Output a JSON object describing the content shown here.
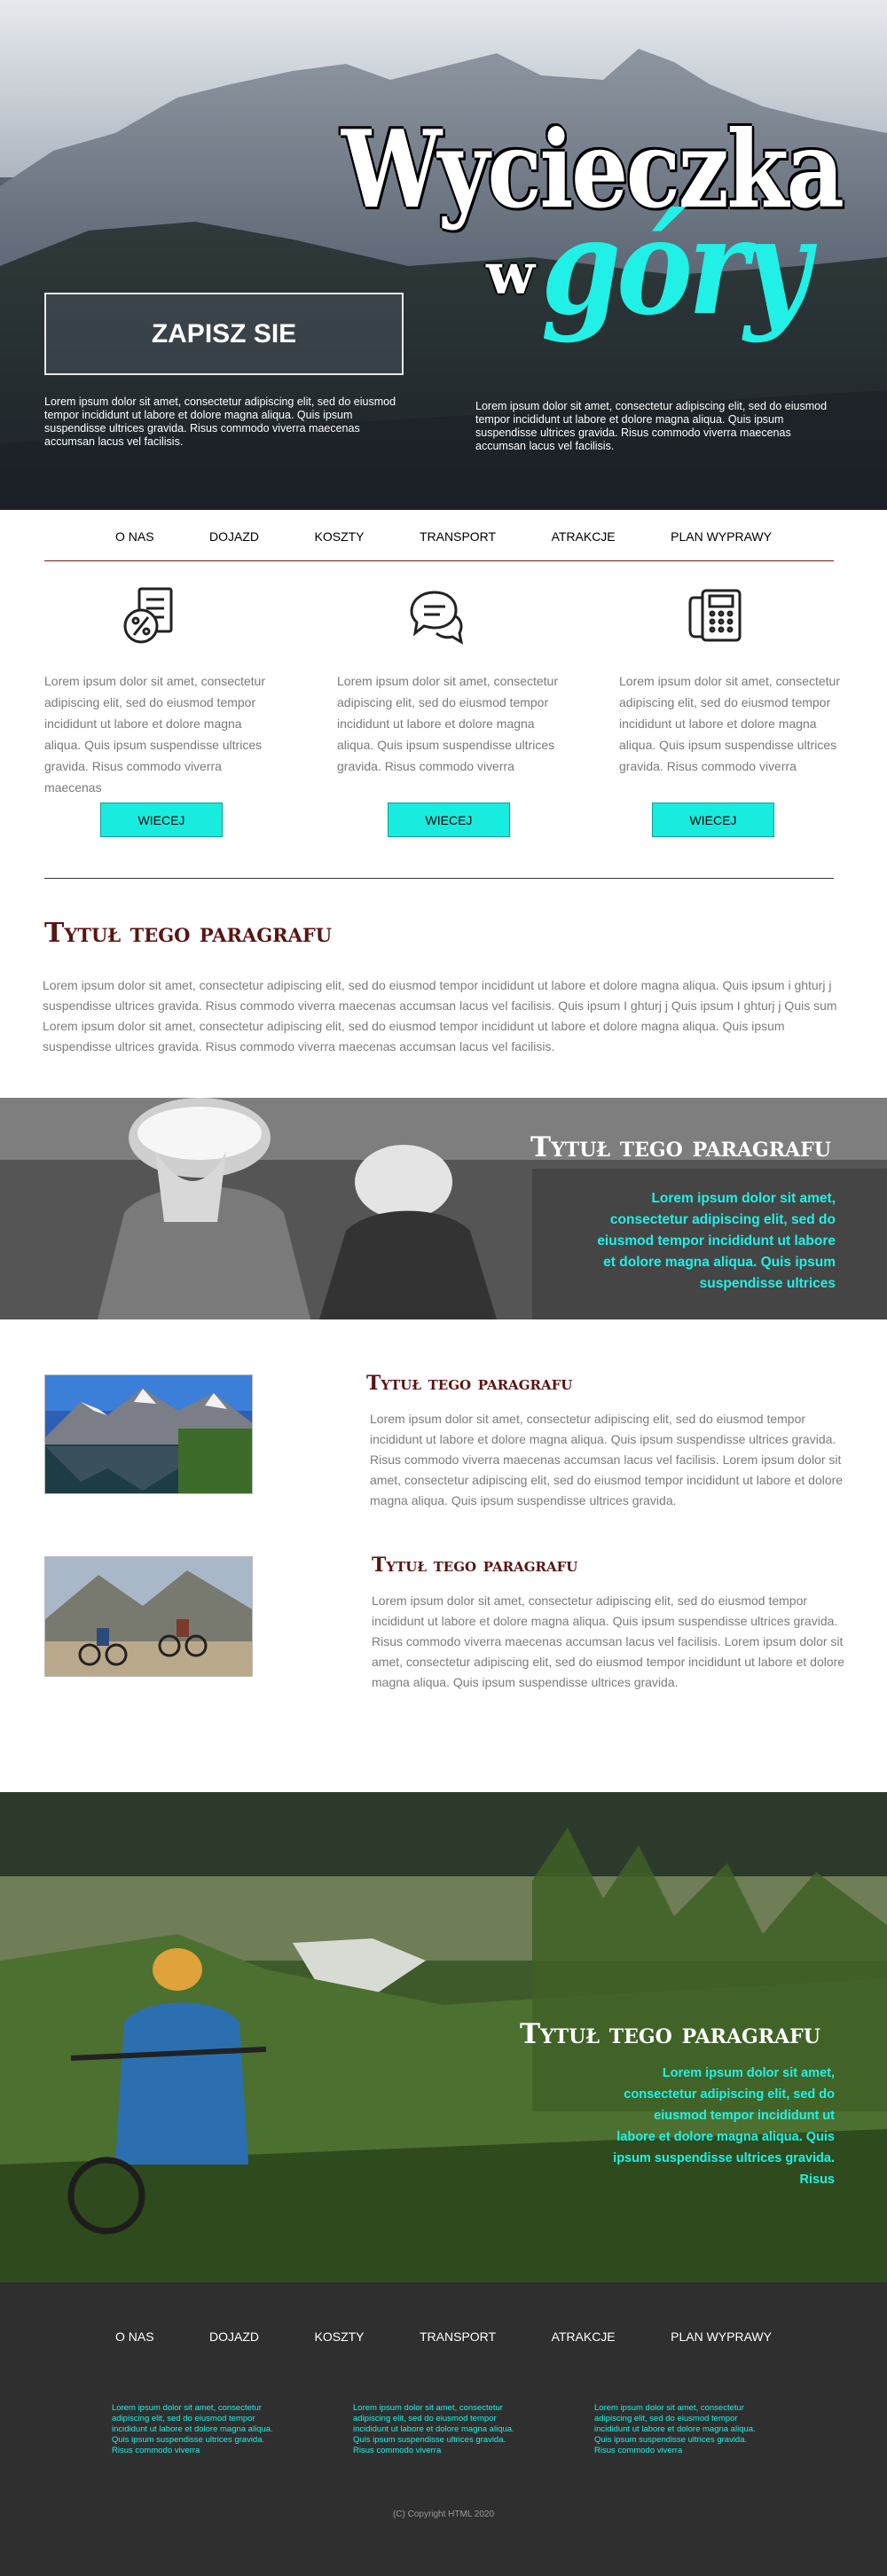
{
  "hero": {
    "title_line1": "Wycieczka",
    "title_w": "w",
    "title_gory": "góry",
    "cta_label": "ZAPISZ SIE",
    "left_text": "Lorem ipsum dolor sit amet, consectetur adipiscing elit, sed do eiusmod tempor incididunt ut labore et dolore magna aliqua. Quis ipsum suspendisse ultrices gravida. Risus commodo viverra maecenas accumsan lacus vel facilisis.",
    "right_text": "Lorem ipsum dolor sit amet, consectetur adipiscing elit, sed do eiusmod tempor incididunt ut labore et dolore magna aliqua. Quis ipsum suspendisse ultrices gravida. Risus commodo viverra maecenas accumsan lacus vel facilisis."
  },
  "nav": {
    "items": [
      {
        "label": "O NAS"
      },
      {
        "label": "DOJAZD"
      },
      {
        "label": "KOSZTY"
      },
      {
        "label": "TRANSPORT"
      },
      {
        "label": "ATRAKCJE"
      },
      {
        "label": "PLAN WYPRAWY"
      }
    ]
  },
  "services": [
    {
      "icon": "percent-document-icon",
      "text": "Lorem ipsum dolor sit amet, consectetur adipiscing elit, sed do eiusmod tempor incididunt ut labore et dolore magna aliqua. Quis ipsum suspendisse ultrices gravida. Risus commodo viverra maecenas",
      "button": "WIECEJ"
    },
    {
      "icon": "chat-bubbles-icon",
      "text": "Lorem ipsum dolor sit amet, consectetur adipiscing elit, sed do eiusmod tempor incididunt ut labore et dolore magna aliqua. Quis ipsum suspendisse ultrices gravida. Risus commodo viverra",
      "button": "WIECEJ"
    },
    {
      "icon": "phone-icon",
      "text": "Lorem ipsum dolor sit amet, consectetur adipiscing elit, sed do eiusmod tempor incididunt ut labore et dolore magna aliqua. Quis ipsum suspendisse ultrices gravida. Risus commodo viverra",
      "button": "WIECEJ"
    }
  ],
  "section1": {
    "title": "Tytuł tego paragrafu",
    "text": "Lorem ipsum dolor sit amet, consectetur adipiscing elit, sed do eiusmod tempor incididunt ut labore et dolore magna aliqua. Quis ipsum i ghturj j suspendisse ultrices gravida. Risus commodo viverra maecenas accumsan lacus vel facilisis. Quis ipsum I ghturj j Quis ipsum I ghturj j Quis sum Lorem ipsum dolor sit amet, consectetur adipiscing elit, sed do eiusmod tempor incididunt ut labore et dolore magna aliqua. Quis ipsum suspendisse ultrices gravida. Risus commodo viverra maecenas accumsan lacus vel facilisis."
  },
  "banner1": {
    "title": "Tytuł tego paragrafu",
    "text": "Lorem ipsum dolor sit amet, consectetur adipiscing elit, sed do eiusmod tempor incididunt ut labore et dolore magna aliqua. Quis ipsum suspendisse ultrices"
  },
  "articles": [
    {
      "title": "Tytuł tego paragrafu",
      "text": "Lorem ipsum dolor sit amet, consectetur adipiscing elit, sed do eiusmod tempor incididunt ut labore et dolore magna aliqua. Quis ipsum suspendisse ultrices gravida. Risus commodo viverra maecenas accumsan lacus vel facilisis. Lorem ipsum dolor sit amet, consectetur adipiscing elit, sed do eiusmod tempor incididunt ut labore et dolore magna aliqua. Quis ipsum suspendisse ultrices gravida."
    },
    {
      "title": "Tytuł tego paragrafu",
      "text": "Lorem ipsum dolor sit amet, consectetur adipiscing elit, sed do eiusmod tempor incididunt ut labore et dolore magna aliqua. Quis ipsum suspendisse ultrices gravida. Risus commodo viverra maecenas accumsan lacus vel facilisis. Lorem ipsum dolor sit amet, consectetur adipiscing elit, sed do eiusmod tempor incididunt ut labore et dolore magna aliqua. Quis ipsum suspendisse ultrices gravida."
    }
  ],
  "banner2": {
    "title": "Tytuł tego paragrafu",
    "text": "Lorem ipsum dolor sit amet, consectetur adipiscing elit, sed do eiusmod tempor incididunt ut labore et dolore magna aliqua. Quis ipsum suspendisse ultrices gravida. Risus"
  },
  "footer": {
    "columns": [
      {
        "text": "Lorem ipsum dolor sit amet, consectetur adipiscing elit, sed do eiusmod tempor incididunt ut labore et dolore magna aliqua. Quis ipsum suspendisse ultrices gravida. Risus commodo viverra"
      },
      {
        "text": "Lorem ipsum dolor sit amet, consectetur adipiscing elit, sed do eiusmod tempor incididunt ut labore et dolore magna aliqua. Quis ipsum suspendisse ultrices gravida. Risus commodo viverra"
      },
      {
        "text": "Lorem ipsum dolor sit amet, consectetur adipiscing elit, sed do eiusmod tempor incididunt ut labore et dolore magna aliqua. Quis ipsum suspendisse ultrices gravida. Risus commodo viverra"
      }
    ],
    "copyright": "(C) Copyright HTML 2020"
  },
  "colors": {
    "accent": "#21f0e6",
    "button": "#18ecdf",
    "heading": "#5a1313",
    "footer_bg": "#2f2f2f"
  }
}
